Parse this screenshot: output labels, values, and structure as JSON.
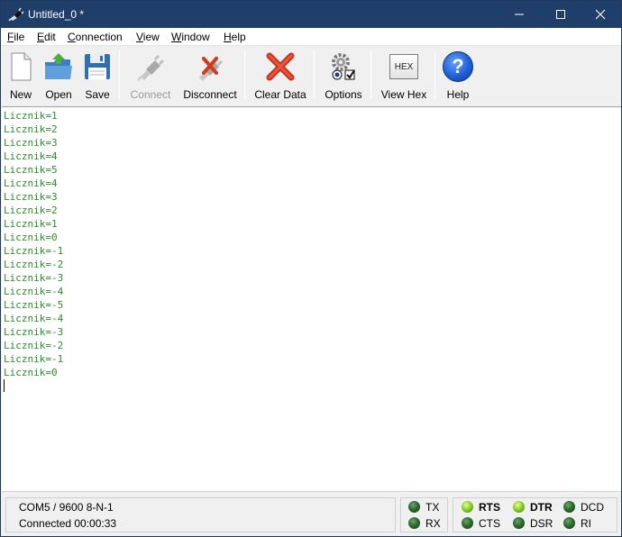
{
  "window": {
    "title": "Untitled_0 *",
    "controls": {
      "minimize": "─",
      "maximize": "☐",
      "close": "✕"
    }
  },
  "menu": [
    {
      "u": "F",
      "rest": "ile"
    },
    {
      "u": "E",
      "rest": "dit"
    },
    {
      "u": "C",
      "rest": "onnection"
    },
    {
      "u": "V",
      "rest": "iew"
    },
    {
      "u": "W",
      "rest": "indow"
    },
    {
      "u": "H",
      "rest": "elp"
    }
  ],
  "toolbar": {
    "new": "New",
    "open": "Open",
    "save": "Save",
    "connect": "Connect",
    "disconnect": "Disconnect",
    "clear_data": "Clear Data",
    "options": "Options",
    "view_hex": "View Hex",
    "hex_icon_text": "HEX",
    "help": "Help",
    "help_icon_text": "?"
  },
  "terminal": {
    "lines": [
      "Licznik=1",
      "Licznik=2",
      "Licznik=3",
      "Licznik=4",
      "Licznik=5",
      "Licznik=4",
      "Licznik=3",
      "Licznik=2",
      "Licznik=1",
      "Licznik=0",
      "Licznik=-1",
      "Licznik=-2",
      "Licznik=-3",
      "Licznik=-4",
      "Licznik=-5",
      "Licznik=-4",
      "Licznik=-3",
      "Licznik=-2",
      "Licznik=-1",
      "Licznik=0"
    ],
    "text_color": "#2e8b2e"
  },
  "status": {
    "port": "COM5 / 9600 8-N-1",
    "connection": "Connected 00:00:33",
    "signals": {
      "tx": "TX",
      "rx": "RX",
      "rts": "RTS",
      "cts": "CTS",
      "dtr": "DTR",
      "dsr": "DSR",
      "dcd": "DCD",
      "ri": "RI"
    }
  }
}
